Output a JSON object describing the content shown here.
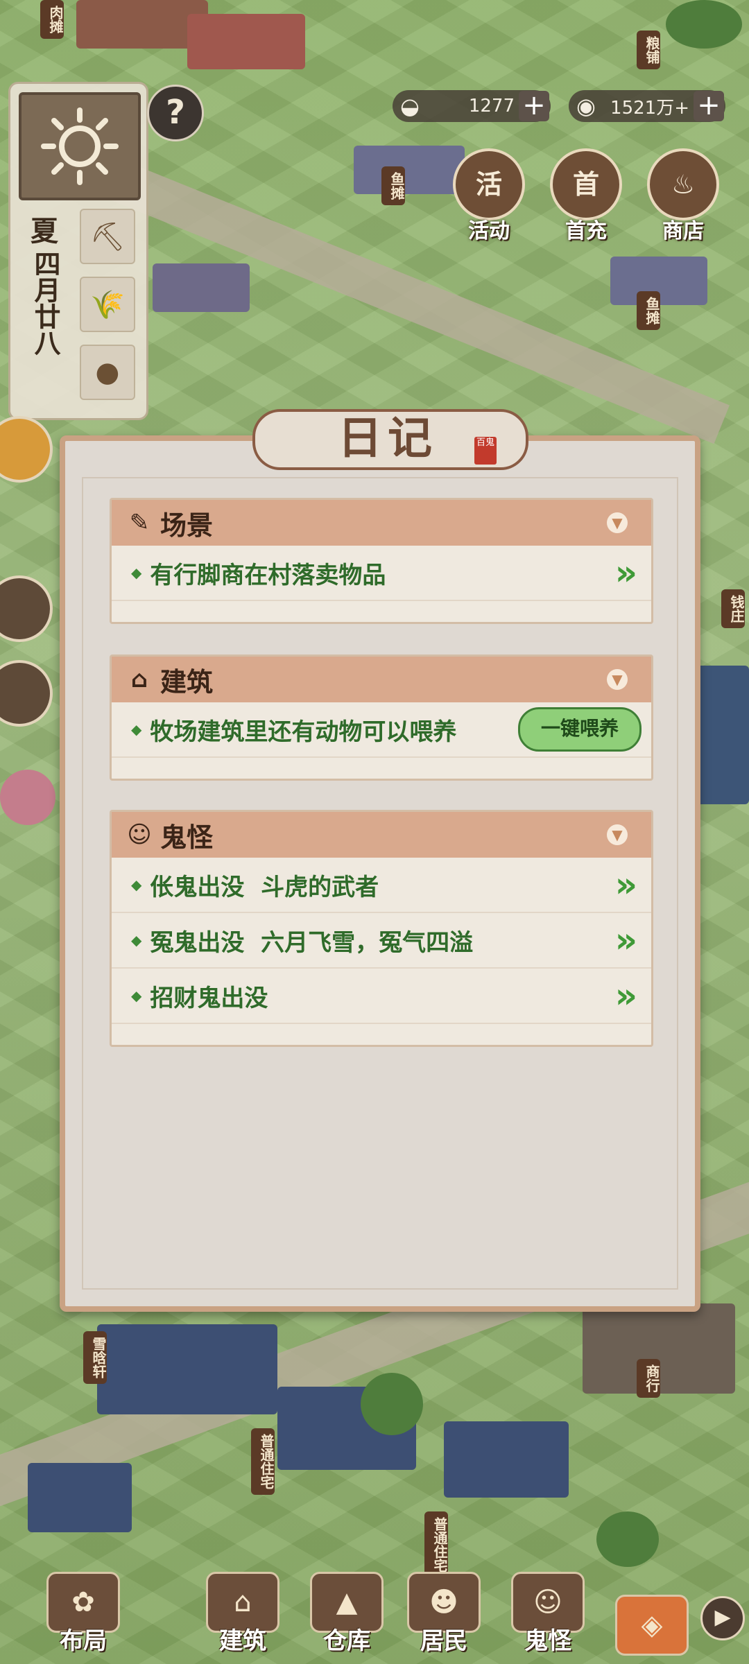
{
  "background": {
    "shop_signs": [
      {
        "text": "肉摊"
      },
      {
        "text": "粮铺"
      },
      {
        "text": "鱼摊"
      },
      {
        "text": "鱼摊"
      },
      {
        "text": "钱庄"
      },
      {
        "text": "雪晗轩"
      },
      {
        "text": "普通住宅"
      },
      {
        "text": "普通住宅"
      },
      {
        "text": "商行"
      }
    ]
  },
  "season_panel": {
    "weather_icon": "sun-icon",
    "season": "夏",
    "date": "四月廿八",
    "tools": [
      "pickaxe-icon",
      "wheat-icon",
      "coins-icon"
    ]
  },
  "help": {
    "symbol": "?"
  },
  "currency": {
    "silver": {
      "icon": "silver-ingot-icon",
      "value": "1277"
    },
    "coin": {
      "icon": "copper-coin-icon",
      "value": "1521万+"
    }
  },
  "shortcuts": [
    {
      "label": "活动",
      "glyph": "活",
      "icon": "scroll-icon"
    },
    {
      "label": "首充",
      "glyph": "首",
      "icon": "money-bag-icon"
    },
    {
      "label": "商店",
      "glyph": "♨",
      "icon": "ingot-shop-icon"
    }
  ],
  "diary": {
    "title": "日记",
    "seal": "百鬼",
    "sections": [
      {
        "key": "scene",
        "title": "场景",
        "icon": "brush-icon",
        "rows": [
          {
            "text": "有行脚商在村落卖物品",
            "action": "»"
          }
        ]
      },
      {
        "key": "building",
        "title": "建筑",
        "icon": "house-icon",
        "rows": [
          {
            "text": "牧场建筑里还有动物可以喂养",
            "button": "一键喂养"
          }
        ]
      },
      {
        "key": "ghost",
        "title": "鬼怪",
        "icon": "ghost-icon",
        "rows": [
          {
            "text": "伥鬼出没  斗虎的武者",
            "action": "»"
          },
          {
            "text": "冤鬼出没  六月飞雪，冤气四溢",
            "action": "»"
          },
          {
            "text": "招财鬼出没",
            "action": "»"
          }
        ]
      }
    ]
  },
  "bottom_nav": [
    {
      "label": "布局",
      "icon": "layout-icon"
    },
    {
      "label": "建筑",
      "icon": "building-icon"
    },
    {
      "label": "仓库",
      "icon": "warehouse-icon"
    },
    {
      "label": "居民",
      "icon": "resident-icon"
    },
    {
      "label": "鬼怪",
      "icon": "ghost-icon"
    }
  ],
  "colors": {
    "section_header": "#d9a98d",
    "row_text": "#2f6b2a",
    "feed_button": "#8fcf79"
  }
}
